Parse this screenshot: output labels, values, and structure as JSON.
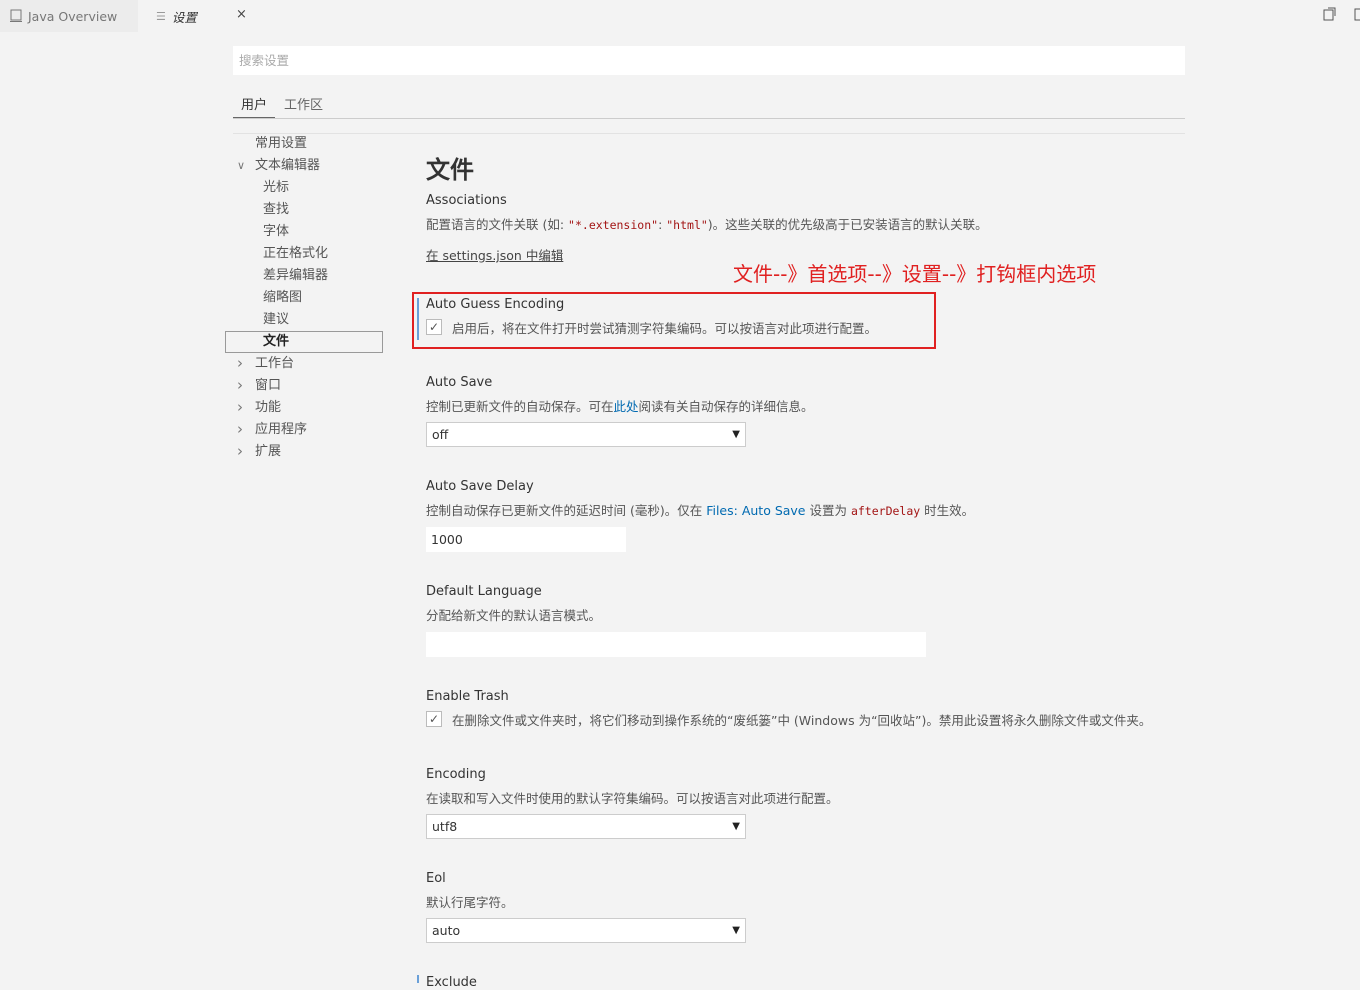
{
  "tabs": {
    "java_overview": "Java Overview",
    "settings": "设置",
    "close_glyph": "×"
  },
  "search": {
    "placeholder": "搜索设置"
  },
  "scope_tabs": {
    "user": "用户",
    "workspace": "工作区"
  },
  "toc": {
    "common": "常用设置",
    "text_editor": "文本编辑器",
    "cursor": "光标",
    "find": "查找",
    "font": "字体",
    "formatting": "正在格式化",
    "diff_editor": "差异编辑器",
    "minimap": "缩略图",
    "suggestions": "建议",
    "files": "文件",
    "workbench": "工作台",
    "window": "窗口",
    "features": "功能",
    "application": "应用程序",
    "extensions": "扩展"
  },
  "section": {
    "title": "文件"
  },
  "settings": {
    "associations": {
      "title": "Associations",
      "desc_prefix": "配置语言的文件关联 (如: ",
      "code1": "\"*.extension\"",
      "colon": ": ",
      "code2": "\"html\"",
      "desc_suffix": ")。这些关联的优先级高于已安装语言的默认关联。",
      "edit_link": "在 settings.json 中编辑"
    },
    "auto_guess_encoding": {
      "title": "Auto Guess Encoding",
      "checked": true,
      "label": "启用后，将在文件打开时尝试猜测字符集编码。可以按语言对此项进行配置。"
    },
    "auto_save": {
      "title": "Auto Save",
      "desc_prefix": "控制已更新文件的自动保存。可在",
      "desc_link": "此处",
      "desc_suffix": "阅读有关自动保存的详细信息。",
      "value": "off"
    },
    "auto_save_delay": {
      "title": "Auto Save Delay",
      "desc_prefix": "控制自动保存已更新文件的延迟时间 (毫秒)。仅在 ",
      "desc_link": "Files: Auto Save",
      "desc_mid": " 设置为 ",
      "desc_code": "afterDelay",
      "desc_suffix": " 时生效。",
      "value": "1000"
    },
    "default_language": {
      "title": "Default Language",
      "desc": "分配给新文件的默认语言模式。",
      "value": ""
    },
    "enable_trash": {
      "title": "Enable Trash",
      "checked": true,
      "label": "在删除文件或文件夹时，将它们移动到操作系统的“废纸篓”中 (Windows 为“回收站”)。禁用此设置将永久删除文件或文件夹。"
    },
    "encoding": {
      "title": "Encoding",
      "desc": "在读取和写入文件时使用的默认字符集编码。可以按语言对此项进行配置。",
      "value": "utf8"
    },
    "eol": {
      "title": "Eol",
      "desc": "默认行尾字符。",
      "value": "auto"
    },
    "exclude": {
      "title": "Exclude"
    }
  },
  "annotation": {
    "text": "文件--》首选项--》设置--》打钩框内选项"
  },
  "glyphs": {
    "check": "✓",
    "dropdown": "▼",
    "chevron_down": "∨",
    "chevron_right": "›"
  },
  "colors": {
    "annotation": "#e02020",
    "link": "#006ab1",
    "focus": "#6aa0d8"
  }
}
